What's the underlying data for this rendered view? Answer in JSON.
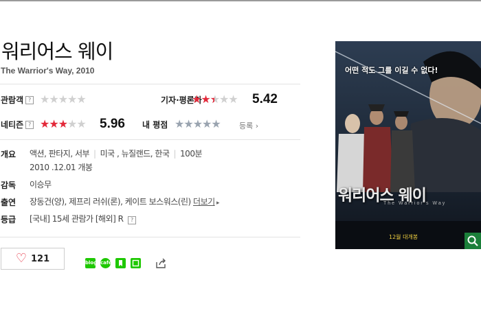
{
  "movie": {
    "title": "워리어스 웨이",
    "subtitle": "The Warrior's Way, 2010"
  },
  "ratings": {
    "audience": {
      "label": "관람객",
      "help": "?",
      "stars": 0
    },
    "critic": {
      "label": "기자·평론가",
      "score": "5.42",
      "stars": 2.5
    },
    "netizen": {
      "label": "네티즌",
      "help": "?",
      "score": "5.96",
      "stars": 3
    },
    "my": {
      "label": "내 평점",
      "register": "등록",
      "stars": 0
    }
  },
  "info": {
    "overview_label": "개요",
    "genres": "액션, 판타지, 서부",
    "countries": "미국 , 뉴질랜드, 한국",
    "runtime": "100분",
    "release": "2010 .12.01 개봉",
    "director_label": "감독",
    "director": "이승무",
    "cast_label": "출연",
    "cast": "장동건(양), 제프리 러쉬(론), 케이트 보스워스(린)",
    "more": "더보기",
    "grade_label": "등급",
    "grade_kr": "[국내]",
    "grade_kr_value": "15세 관람가",
    "grade_intl": "[해외]",
    "grade_intl_value": "R",
    "help": "?"
  },
  "actions": {
    "like_count": "121",
    "share_buttons": [
      {
        "icon": "blog-share-icon",
        "text": "blog",
        "color": "#1ec800"
      },
      {
        "icon": "cafe-share-icon",
        "text": "cafe",
        "color": "#1ec800"
      },
      {
        "icon": "bookmark-share-icon",
        "text": "",
        "color": "#1ec800"
      },
      {
        "icon": "memo-share-icon",
        "text": "",
        "color": "#1ec800"
      }
    ]
  },
  "poster": {
    "tagline": "어떤 적도 그를 이길 수 없다!",
    "title": "워리어스 웨이",
    "english": "The Warrior's Way",
    "date": "12월 대개봉"
  },
  "colors": {
    "star_red": "#e3293a",
    "star_empty": "#d0d0d0",
    "star_grey": "#9aa4b0",
    "share_green": "#1ec800"
  }
}
